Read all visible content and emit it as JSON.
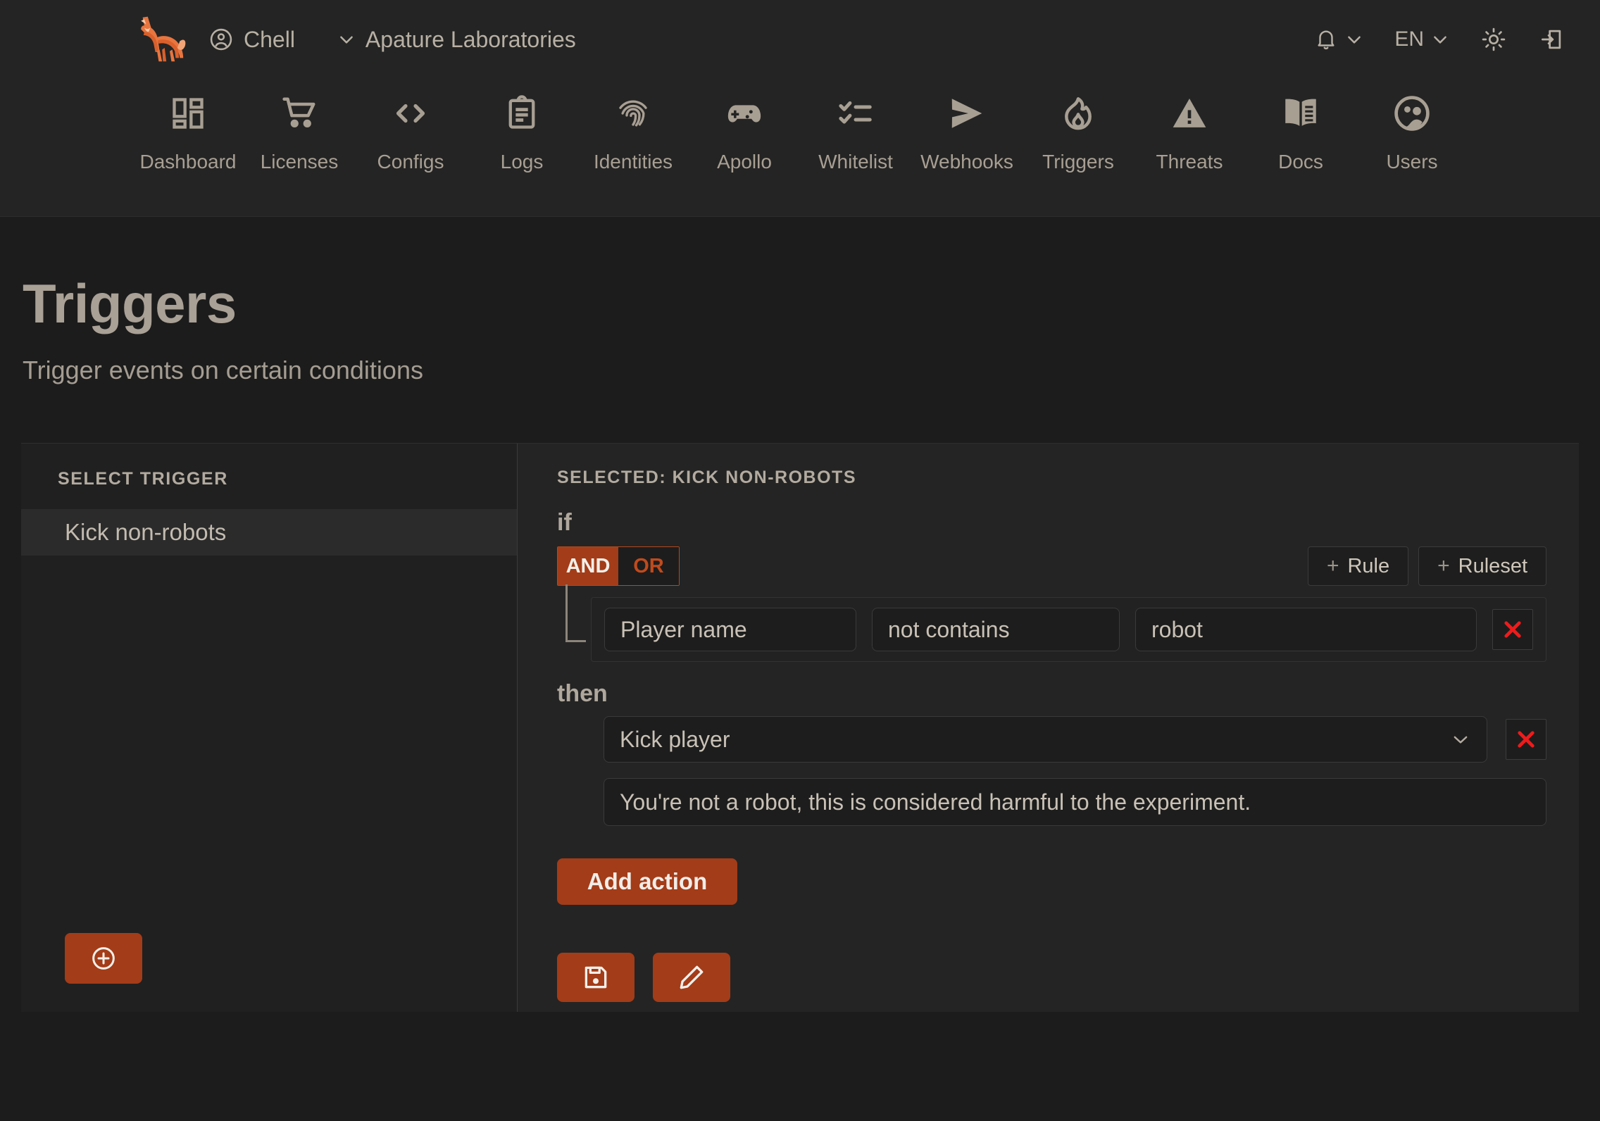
{
  "topbar": {
    "logo_icon": "fox-logo",
    "user_icon": "user-circle-icon",
    "user_name": "Chell",
    "org_chevron_icon": "chevron-down-icon",
    "org_name": "Apature Laboratories",
    "notifications_icon": "bell-icon",
    "notifications_chevron_icon": "chevron-down-icon",
    "language_label": "EN",
    "language_chevron_icon": "chevron-down-icon",
    "theme_icon": "sun-icon",
    "logout_icon": "logout-icon"
  },
  "nav": {
    "items": [
      {
        "label": "Dashboard",
        "icon": "dashboard-grid-icon"
      },
      {
        "label": "Licenses",
        "icon": "shopping-cart-icon"
      },
      {
        "label": "Configs",
        "icon": "code-brackets-icon"
      },
      {
        "label": "Logs",
        "icon": "clipboard-list-icon"
      },
      {
        "label": "Identities",
        "icon": "fingerprint-icon"
      },
      {
        "label": "Apollo",
        "icon": "gamepad-icon"
      },
      {
        "label": "Whitelist",
        "icon": "checklist-icon"
      },
      {
        "label": "Webhooks",
        "icon": "send-arrow-icon"
      },
      {
        "label": "Triggers",
        "icon": "flame-icon"
      },
      {
        "label": "Threats",
        "icon": "warning-triangle-icon"
      },
      {
        "label": "Docs",
        "icon": "open-book-icon"
      },
      {
        "label": "Users",
        "icon": "users-circle-icon"
      }
    ]
  },
  "page": {
    "title": "Triggers",
    "subtitle": "Trigger events on certain conditions"
  },
  "left_panel": {
    "heading": "SELECT TRIGGER",
    "triggers": [
      {
        "label": "Kick non-robots",
        "selected": true
      }
    ],
    "add_button_icon": "plus-circle-icon"
  },
  "right_panel": {
    "heading": "SELECTED: KICK NON-ROBOTS",
    "if_label": "if",
    "then_label": "then",
    "logic": {
      "and_label": "AND",
      "or_label": "OR",
      "active": "AND"
    },
    "add_rule_label": "Rule",
    "add_rule_plus": "+",
    "add_ruleset_label": "Ruleset",
    "add_ruleset_plus": "+",
    "rule": {
      "field": "Player name",
      "operator": "not contains",
      "value": "robot",
      "delete_icon": "close-x-icon"
    },
    "action": {
      "selected": "Kick player",
      "chevron_icon": "chevron-down-icon",
      "delete_icon": "close-x-icon",
      "message": "You're not a robot, this is considered harmful to the experiment."
    },
    "add_action_label": "Add action",
    "save_icon": "floppy-save-icon",
    "edit_icon": "pencil-edit-icon"
  },
  "colors": {
    "accent": "#a33c18",
    "accent_border": "#b04a1f",
    "danger": "#ef1b1b",
    "text": "#b5ada1",
    "bg": "#1c1c1c",
    "panel_bg": "#242424",
    "sidebar_bg": "#202020"
  }
}
